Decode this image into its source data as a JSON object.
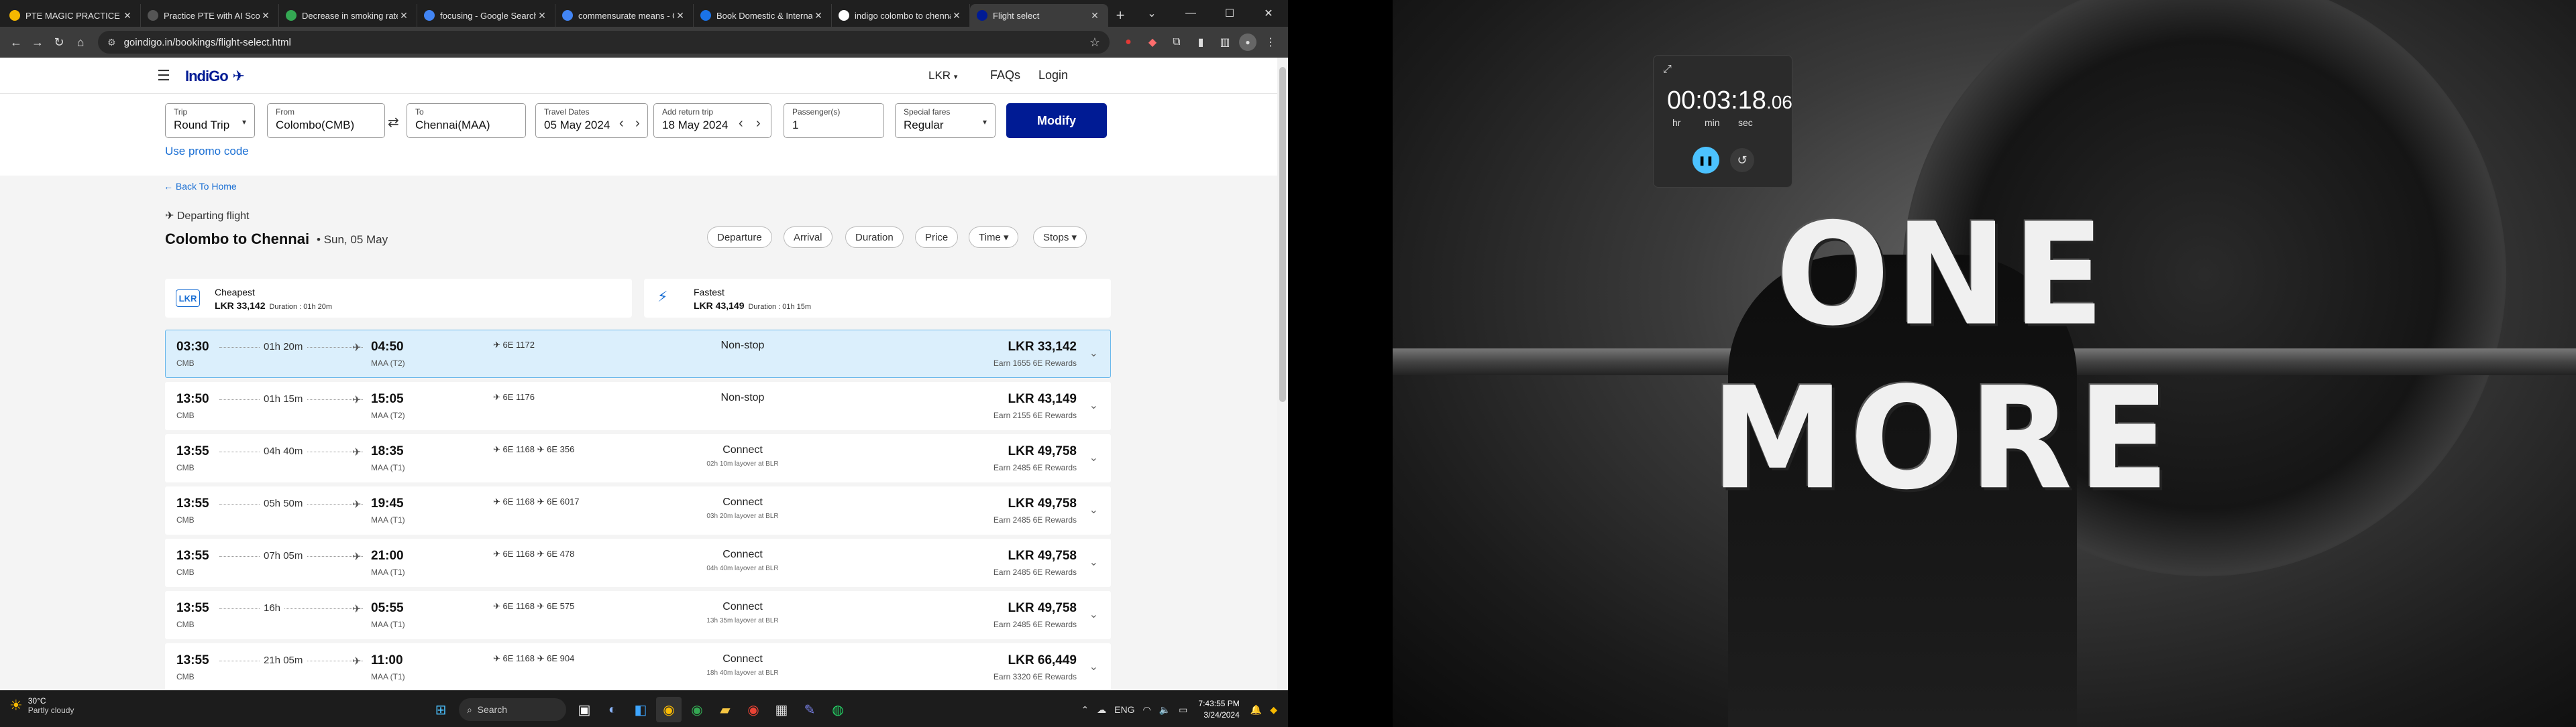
{
  "browser": {
    "tabs": [
      {
        "title": "PTE MAGIC PRACTICE",
        "color": "#f5b800"
      },
      {
        "title": "Practice PTE with AI Scori",
        "color": "#555555"
      },
      {
        "title": "Decrease in smoking rate",
        "color": "#34a853"
      },
      {
        "title": "focusing - Google Search",
        "color": "#4285f4"
      },
      {
        "title": "commensurate means - G",
        "color": "#4285f4"
      },
      {
        "title": "Book Domestic & Internati",
        "color": "#1a73e8"
      },
      {
        "title": "indigo colombo to chenna",
        "color": "#ffffff"
      },
      {
        "title": "Flight select",
        "color": "#001b94"
      }
    ],
    "url": "goindigo.in/bookings/flight-select.html"
  },
  "site": {
    "logo": "IndiGo",
    "currency": "LKR",
    "faqs": "FAQs",
    "login": "Login"
  },
  "search": {
    "trip_label": "Trip",
    "trip_value": "Round Trip",
    "from_label": "From",
    "from_value": "Colombo(CMB)",
    "to_label": "To",
    "to_value": "Chennai(MAA)",
    "travel_label": "Travel Dates",
    "travel_value": "05 May 2024",
    "return_label": "Add return trip",
    "return_value": "18 May 2024",
    "pax_label": "Passenger(s)",
    "pax_value": "1",
    "fares_label": "Special fares",
    "fares_value": "Regular",
    "modify": "Modify",
    "promo": "Use promo code"
  },
  "results": {
    "back": "Back To Home",
    "departing": "Departing flight",
    "route": "Colombo to Chennai",
    "date": "Sun, 05 May",
    "sort": [
      "Departure",
      "Arrival",
      "Duration",
      "Price",
      "Time",
      "Stops"
    ],
    "cheapest": {
      "label": "Cheapest",
      "currency": "LKR",
      "price": "LKR 33,142",
      "duration": "Duration : 01h 20m"
    },
    "fastest": {
      "label": "Fastest",
      "price": "LKR 43,149",
      "duration": "Duration : 01h 15m"
    },
    "flights": [
      {
        "dep": "03:30",
        "dep_code": "CMB",
        "dur": "01h 20m",
        "arr": "04:50",
        "arr_code": "MAA (T2)",
        "flight": "6E 1172",
        "stops": "Non-stop",
        "layover": "",
        "price": "LKR 33,142",
        "rewards": "Earn 1655 6E Rewards"
      },
      {
        "dep": "13:50",
        "dep_code": "CMB",
        "dur": "01h 15m",
        "arr": "15:05",
        "arr_code": "MAA (T2)",
        "flight": "6E 1176",
        "stops": "Non-stop",
        "layover": "",
        "price": "LKR 43,149",
        "rewards": "Earn 2155 6E Rewards"
      },
      {
        "dep": "13:55",
        "dep_code": "CMB",
        "dur": "04h 40m",
        "arr": "18:35",
        "arr_code": "MAA (T1)",
        "flight": "6E 1168  ✈ 6E 356",
        "stops": "Connect",
        "layover": "02h 10m layover at BLR",
        "price": "LKR 49,758",
        "rewards": "Earn 2485 6E Rewards"
      },
      {
        "dep": "13:55",
        "dep_code": "CMB",
        "dur": "05h 50m",
        "arr": "19:45",
        "arr_code": "MAA (T1)",
        "flight": "6E 1168  ✈ 6E 6017",
        "stops": "Connect",
        "layover": "03h 20m layover at BLR",
        "price": "LKR 49,758",
        "rewards": "Earn 2485 6E Rewards"
      },
      {
        "dep": "13:55",
        "dep_code": "CMB",
        "dur": "07h 05m",
        "arr": "21:00",
        "arr_code": "MAA (T1)",
        "flight": "6E 1168  ✈ 6E 478",
        "stops": "Connect",
        "layover": "04h 40m layover at BLR",
        "price": "LKR 49,758",
        "rewards": "Earn 2485 6E Rewards"
      },
      {
        "dep": "13:55",
        "dep_code": "CMB",
        "dur": "16h",
        "arr": "05:55",
        "arr_code": "MAA (T1)",
        "flight": "6E 1168  ✈ 6E 575",
        "stops": "Connect",
        "layover": "13h 35m layover at BLR",
        "price": "LKR 49,758",
        "rewards": "Earn 2485 6E Rewards"
      },
      {
        "dep": "13:55",
        "dep_code": "CMB",
        "dur": "21h 05m",
        "arr": "11:00",
        "arr_code": "MAA (T1)",
        "flight": "6E 1168  ✈ 6E 904",
        "stops": "Connect",
        "layover": "18h 40m layover at BLR",
        "price": "LKR 66,449",
        "rewards": "Earn 3320 6E Rewards"
      }
    ]
  },
  "wallpaper": {
    "text": "ONE MORE"
  },
  "timer": {
    "digits": "00:03:18",
    "fraction": ".06",
    "hr": "hr",
    "min": "min",
    "sec": "sec"
  },
  "taskbar": {
    "temp": "30°C",
    "weather": "Partly cloudy",
    "search": "Search",
    "lang": "ENG",
    "time": "7:43:55 PM",
    "date": "3/24/2024"
  }
}
